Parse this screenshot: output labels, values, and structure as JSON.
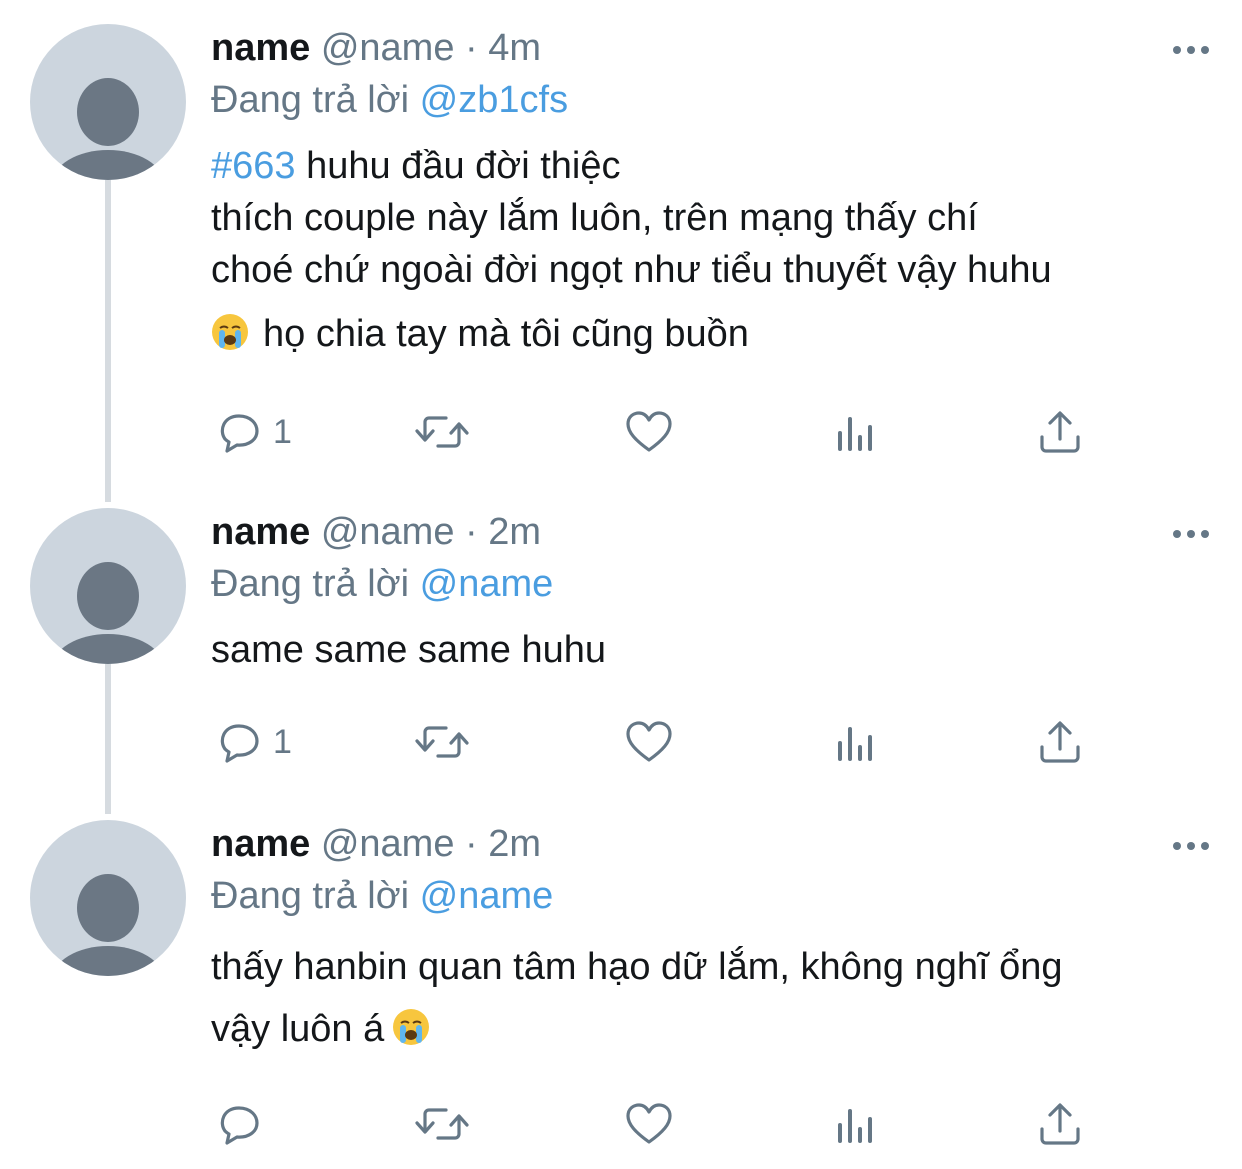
{
  "tweets": [
    {
      "display_name": "name",
      "handle": "@name",
      "separator": "·",
      "time": "4m",
      "reply_prefix": "Đang trả lời",
      "reply_to": "@zb1cfs",
      "hashtag": "#663",
      "line1_rest": " huhu đầu đời thiệc",
      "line2": "thích couple này lắm luôn, trên mạng thấy chí",
      "line3": "choé chứ ngoài đời ngọt như tiểu thuyết vậy huhu",
      "line4": "họ chia tay mà tôi cũng buồn",
      "reply_count": "1",
      "icons": [
        "avatar-icon",
        "more-icon",
        "reply-icon",
        "retweet-icon",
        "like-icon",
        "stats-icon",
        "share-icon",
        "crying-face-icon"
      ]
    },
    {
      "display_name": "name",
      "handle": "@name",
      "separator": "·",
      "time": "2m",
      "reply_prefix": "Đang trả lời",
      "reply_to": "@name",
      "line1": "same same same huhu",
      "reply_count": "1"
    },
    {
      "display_name": "name",
      "handle": "@name",
      "separator": "·",
      "time": "2m",
      "reply_prefix": "Đang trả lời",
      "reply_to": "@name",
      "line1": "thấy hanbin quan tâm hạo dữ lắm, không nghĩ ổng",
      "line2": "vậy luôn á",
      "reply_count": ""
    }
  ],
  "colors": {
    "text": "#14171a",
    "muted": "#657786",
    "link": "#4a9de0",
    "avatar_bg": "#ccd5de",
    "avatar_fg": "#6b7784",
    "thread_line": "#d6dbe0"
  }
}
